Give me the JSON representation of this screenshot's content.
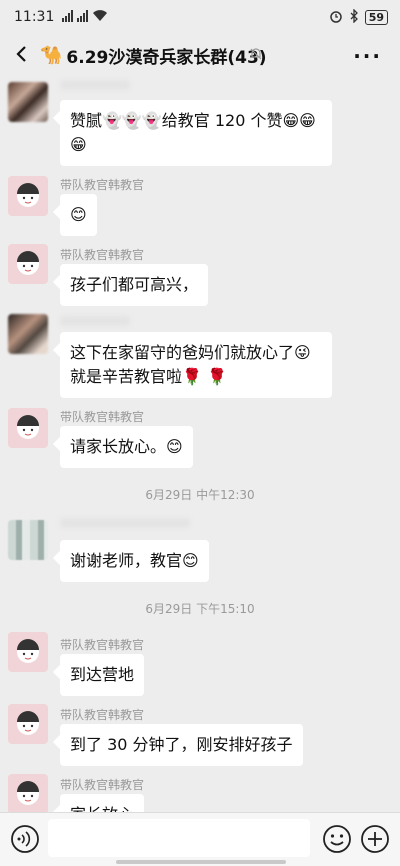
{
  "status_bar": {
    "time": "11:31",
    "signal": "📶📶",
    "battery": "59"
  },
  "header": {
    "title": "6.29沙漠奇兵家长群(43)",
    "camel_emoji": "🐪"
  },
  "messages": [
    {
      "sender": "",
      "text": "赞腻👻👻👻给教官 120 个赞😁😁😁"
    },
    {
      "sender": "带队教官韩教官",
      "text": "😊"
    },
    {
      "sender": "带队教官韩教官",
      "text": "孩子们都可高兴，"
    },
    {
      "sender": "",
      "text": "这下在家留守的爸妈们就放心了😜就是辛苦教官啦🌹 🌹"
    },
    {
      "sender": "带队教官韩教官",
      "text": "请家长放心。😊"
    },
    {
      "sender": "",
      "text": "谢谢老师，教官😊"
    },
    {
      "sender": "带队教官韩教官",
      "text": "到达营地"
    },
    {
      "sender": "带队教官韩教官",
      "text": "到了 30 分钟了，刚安排好孩子"
    },
    {
      "sender": "带队教官韩教官",
      "text": "家长放心"
    }
  ],
  "timestamps": [
    "6月29日 中午12:30",
    "6月29日 下午15:10"
  ],
  "input": {
    "placeholder": ""
  },
  "colors": {
    "background": "#ededed",
    "bubble": "#ffffff",
    "instructor_avatar": "#f0d4d8"
  }
}
